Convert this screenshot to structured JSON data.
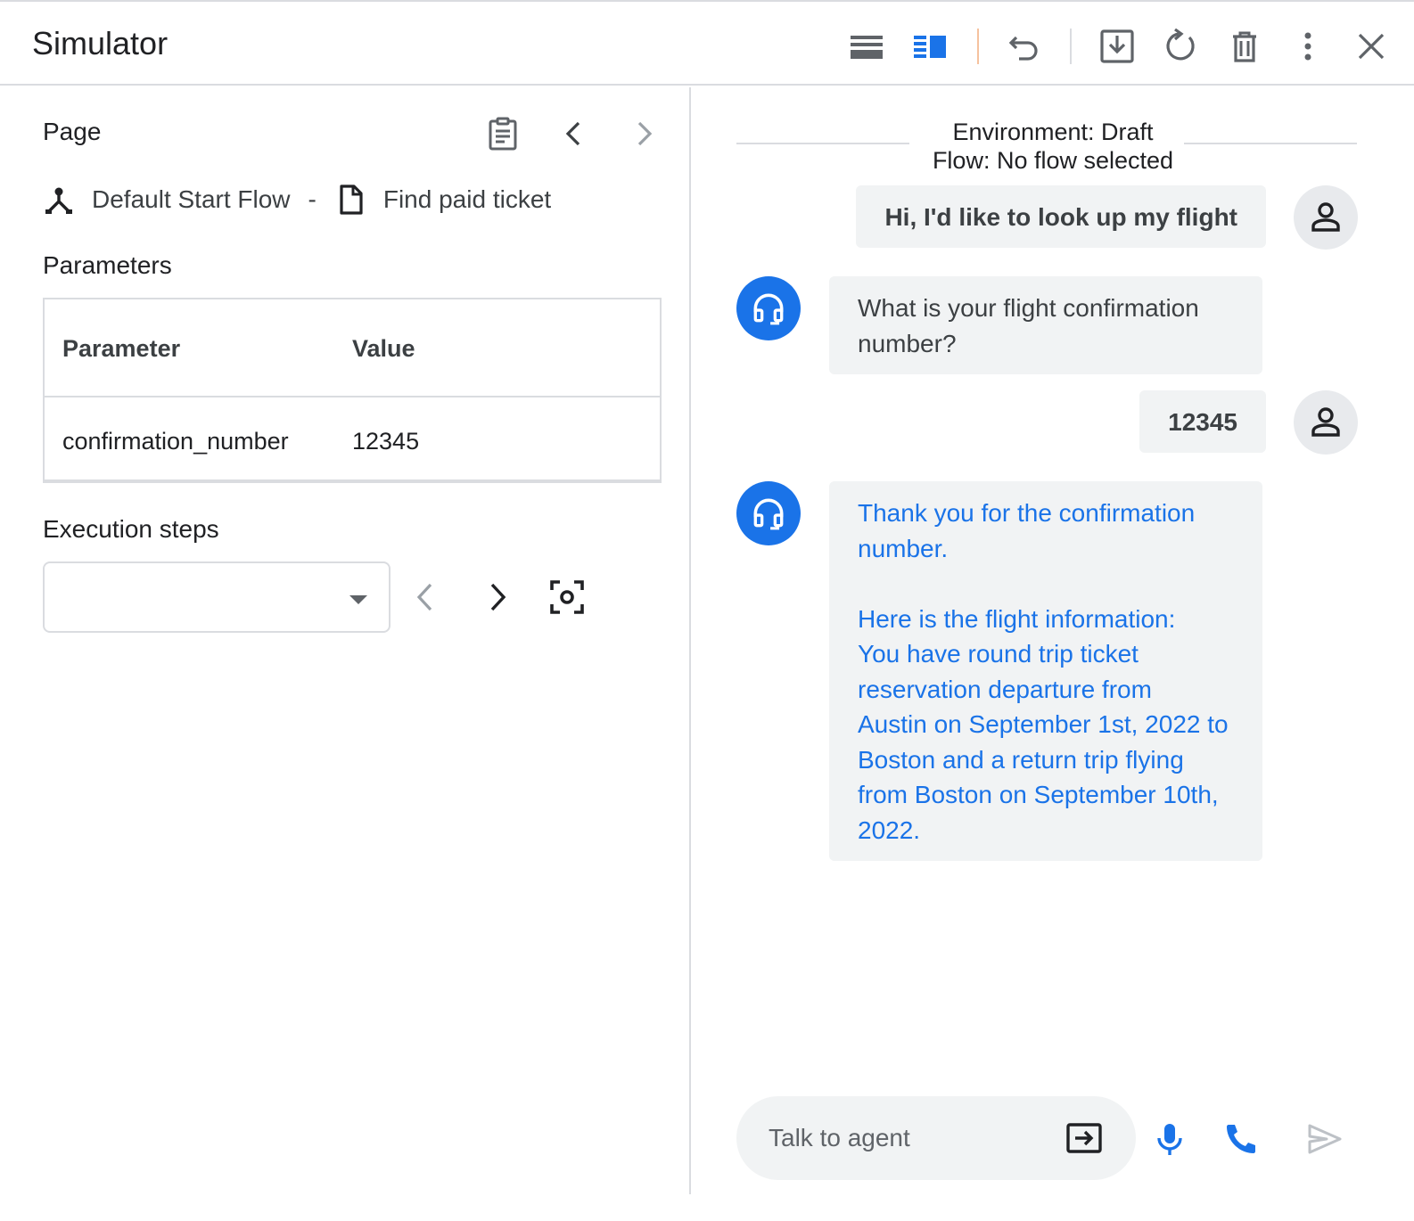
{
  "header": {
    "title": "Simulator"
  },
  "page_section": {
    "title": "Page",
    "flow_name": "Default Start Flow",
    "separator": "-",
    "page_name": "Find paid ticket"
  },
  "parameters": {
    "title": "Parameters",
    "columns": [
      "Parameter",
      "Value"
    ],
    "rows": [
      {
        "name": "confirmation_number",
        "value": "12345"
      }
    ]
  },
  "execution": {
    "title": "Execution steps",
    "selected": ""
  },
  "chat": {
    "environment": "Environment: Draft",
    "flow": "Flow: No flow selected",
    "messages": [
      {
        "role": "user",
        "text": "Hi, I'd like to look up my flight"
      },
      {
        "role": "agent",
        "text": "What is your flight confirmation\nnumber?"
      },
      {
        "role": "user",
        "text": "12345"
      },
      {
        "role": "agent",
        "text": "Thank you for the confirmation\nnumber.\n\nHere is the flight information:\nYou have round trip ticket\nreservation departure from\nAustin on September 1st, 2022 to\nBoston and a return trip flying\nfrom Boston on September 10th,\n2022."
      }
    ],
    "input_placeholder": "Talk to agent"
  },
  "colors": {
    "accent": "#1a73e8",
    "bubble_bg": "#f1f3f4",
    "border": "#dadce0",
    "icon_dark": "#5f6368"
  }
}
